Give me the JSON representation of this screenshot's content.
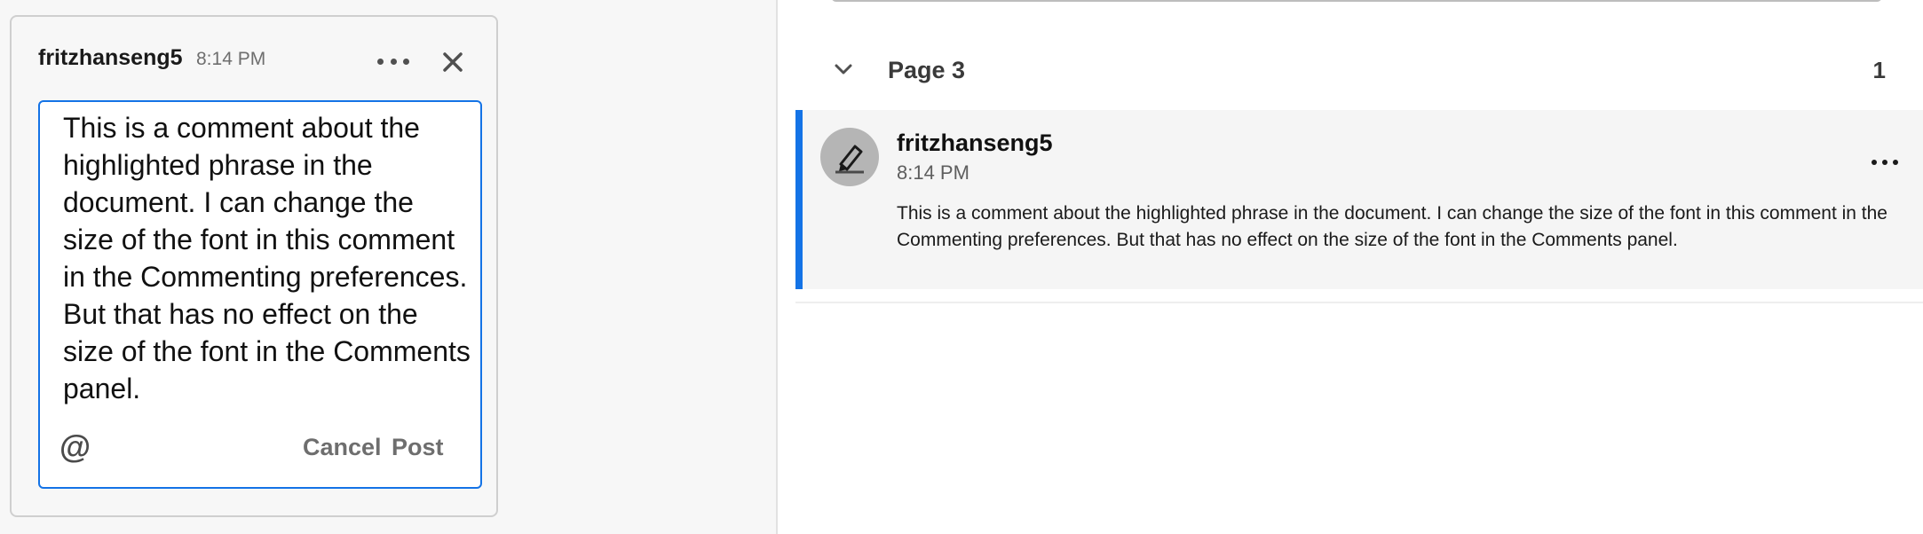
{
  "popup": {
    "author": "fritzhanseng5",
    "time": "8:14 PM",
    "more_icon": "more-horizontal-icon",
    "close_icon": "close-icon",
    "editor": {
      "text": "This is a comment about the highlighted phrase in the document. I can change the size of the font in this comment in the Commenting preferences. But that has no effect on the size of the font in the Comments panel.",
      "mention_symbol": "@",
      "cancel_label": "Cancel",
      "post_label": "Post"
    }
  },
  "panel": {
    "group": {
      "title": "Page 3",
      "count": "1",
      "chevron_icon": "chevron-down-icon"
    },
    "comments": [
      {
        "author": "fritzhanseng5",
        "time": "8:14 PM",
        "avatar_icon": "highlight-pen-icon",
        "text": "This is a comment about the highlighted phrase in the document. I can change the size of the font in this comment in the Commenting preferences. But that has no effect on the size of the font in the Comments panel."
      }
    ]
  },
  "colors": {
    "accent": "#1473e6",
    "card_background": "#f5f5f5",
    "canvas_background": "#f7f7f7"
  }
}
